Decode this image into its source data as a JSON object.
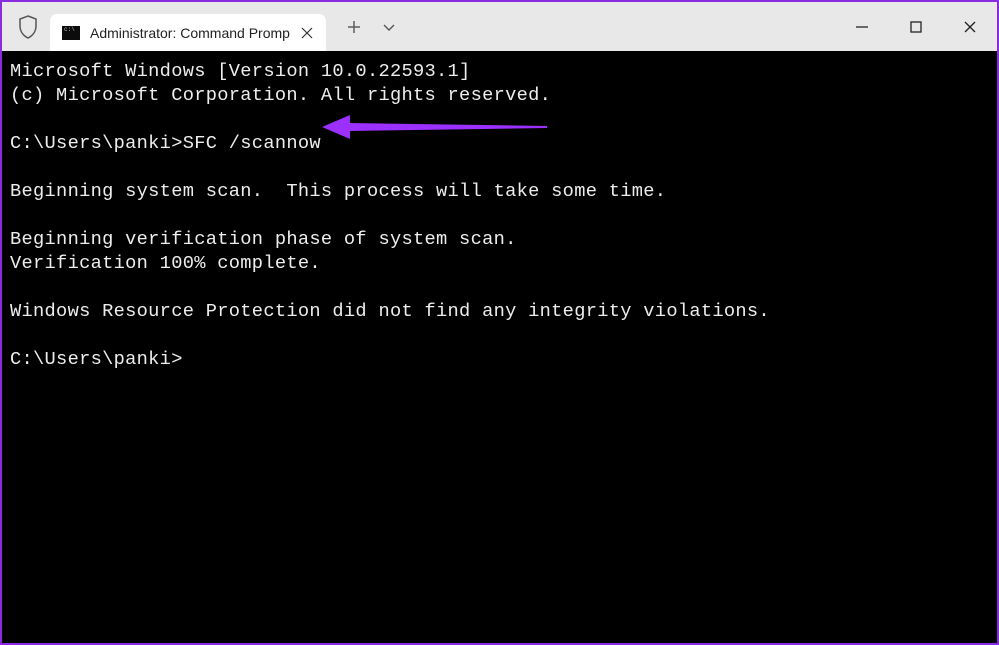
{
  "tab": {
    "title": "Administrator: Command Promp"
  },
  "terminal": {
    "line1": "Microsoft Windows [Version 10.0.22593.1]",
    "line2": "(c) Microsoft Corporation. All rights reserved.",
    "blank1": "",
    "prompt1": "C:\\Users\\panki>SFC /scannow",
    "blank2": "",
    "line3": "Beginning system scan.  This process will take some time.",
    "blank3": "",
    "line4": "Beginning verification phase of system scan.",
    "line5": "Verification 100% complete.",
    "blank4": "",
    "line6": "Windows Resource Protection did not find any integrity violations.",
    "blank5": "",
    "prompt2": "C:\\Users\\panki>"
  }
}
